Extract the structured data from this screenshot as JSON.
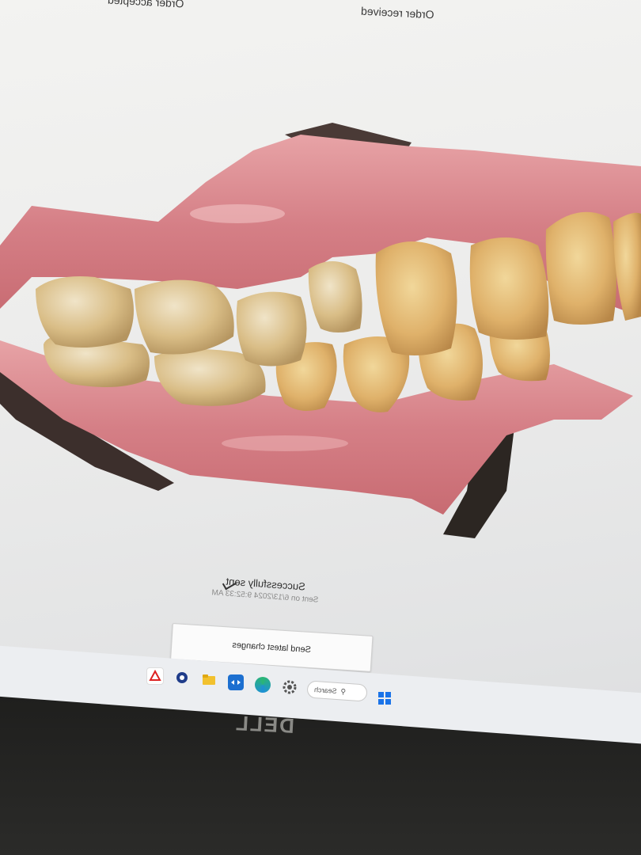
{
  "steps": {
    "accepted": "Order accepted",
    "received": "Order received"
  },
  "status": {
    "title": "Successfully sent",
    "subtitle": "Sent on 6/13/2024 9:52:33 AM"
  },
  "actions": {
    "send_label": "Send latest changes"
  },
  "taskbar": {
    "search_placeholder": "Search",
    "apps": [
      "red-triangle-app-icon",
      "blue-gear-app-icon",
      "folder-icon",
      "teamviewer-icon",
      "edge-browser-icon",
      "settings-icon"
    ]
  },
  "monitor": {
    "brand": "DELL"
  },
  "colors": {
    "gum": "#d9858a",
    "tooth": "#dcc79a",
    "screen": "#ececeb",
    "taskbar": "#eceef1"
  }
}
